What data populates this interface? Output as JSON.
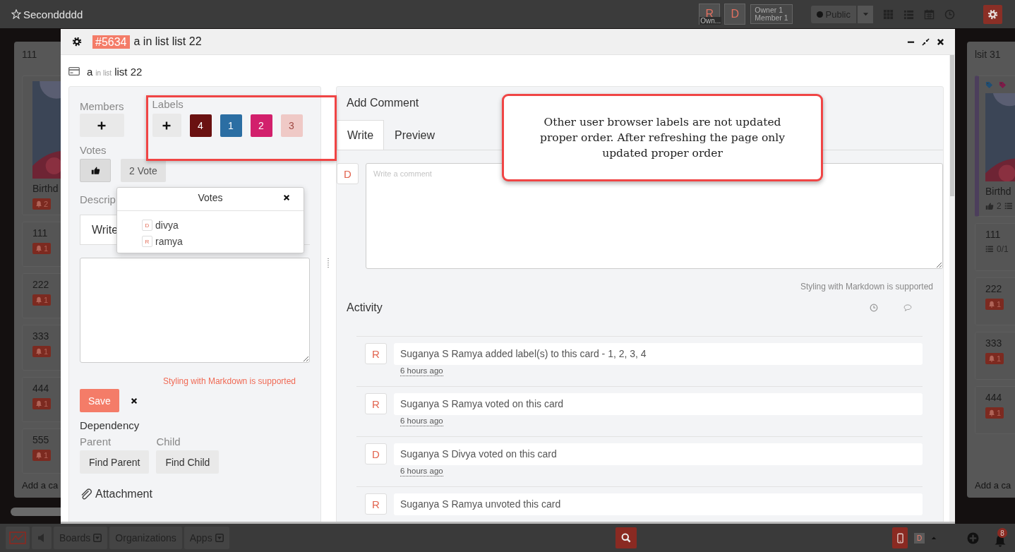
{
  "top_bar": {
    "board_title": "Seconddddd",
    "members": [
      {
        "initial": "R",
        "tag": "Own..."
      },
      {
        "initial": "D"
      }
    ],
    "roles": [
      "Owner 1",
      "Member 1"
    ],
    "visibility": "Public"
  },
  "left_list": {
    "title": "111",
    "cards": [
      {
        "kind": "picture",
        "title": "Birthd",
        "notifications": "2"
      },
      {
        "kind": "plain",
        "title": "111",
        "notifications": "1"
      },
      {
        "kind": "plain",
        "title": "222",
        "notifications": "1"
      },
      {
        "kind": "plain",
        "title": "333",
        "notifications": "1"
      },
      {
        "kind": "plain",
        "title": "444",
        "notifications": "1"
      },
      {
        "kind": "plain",
        "title": "555",
        "notifications": "1"
      }
    ],
    "add_card": "Add a ca"
  },
  "card_modal": {
    "card_id": "#5634",
    "title": "a in list list 22",
    "name": "a",
    "list_prefix": "in list",
    "list_name": "list 22",
    "members": {
      "heading": "Members"
    },
    "labels": {
      "heading": "Labels",
      "items": [
        {
          "text": "4",
          "color": "#6a1111"
        },
        {
          "text": "1",
          "color": "#2b6ea3"
        },
        {
          "text": "2",
          "color": "#d2206c"
        },
        {
          "text": "3",
          "color": "#efc9c6"
        }
      ]
    },
    "votes": {
      "heading": "Votes",
      "count": "2 Vote",
      "popover": {
        "title": "Votes",
        "voters": [
          {
            "initial": "D",
            "name": "divya"
          },
          {
            "initial": "R",
            "name": "ramya"
          }
        ]
      }
    },
    "description": {
      "heading": "Descrip",
      "tab": "Write",
      "hint": "Styling with Markdown is supported",
      "save": "Save"
    },
    "dependency": {
      "heading": "Dependency",
      "parent_label": "Parent",
      "child_label": "Child",
      "find_parent": "Find Parent",
      "find_child": "Find Child"
    },
    "attachment": {
      "heading": "Attachment"
    },
    "comment": {
      "heading": "Add Comment",
      "tabs": [
        {
          "label": "Write",
          "selected": true
        },
        {
          "label": "Preview",
          "selected": false
        }
      ],
      "avatar": "D",
      "placeholder": "Write a comment",
      "hint": "Styling with Markdown is supported"
    },
    "activity": {
      "heading": "Activity",
      "items": [
        {
          "avatar": "R",
          "text": "Suganya S Ramya added label(s) to this card - 1, 2, 3, 4",
          "time": "6 hours ago"
        },
        {
          "avatar": "R",
          "text": "Suganya S Ramya voted on this card",
          "time": "6 hours ago"
        },
        {
          "avatar": "D",
          "text": "Suganya S Divya voted on this card",
          "time": "6 hours ago"
        },
        {
          "avatar": "R",
          "text": "Suganya S Ramya unvoted this card"
        }
      ]
    }
  },
  "annotation": {
    "text": "Other user browser labels are not updated proper order. After refreshing the page only updated proper order"
  },
  "right_list": {
    "title": "lsit 31",
    "cards": [
      {
        "kind": "picture",
        "title": "Birthd",
        "votes": "2",
        "tags": [
          {
            "color": "#1f4e74"
          },
          {
            "color": "#7e1a48"
          }
        ]
      },
      {
        "kind": "checklist",
        "title": "111",
        "checklist": "0/1"
      },
      {
        "kind": "plain",
        "title": "222",
        "notifications": "1"
      },
      {
        "kind": "plain",
        "title": "333",
        "notifications": "1"
      },
      {
        "kind": "plain",
        "title": "444",
        "notifications": "1"
      }
    ],
    "add_card": "Add a ca"
  },
  "bottom_bar": {
    "menus": [
      {
        "label": "Boards",
        "dropdown": true
      },
      {
        "label": "Organizations",
        "dropdown": false
      },
      {
        "label": "Apps",
        "dropdown": true
      }
    ],
    "avatar": "D",
    "notification_count": "8"
  }
}
